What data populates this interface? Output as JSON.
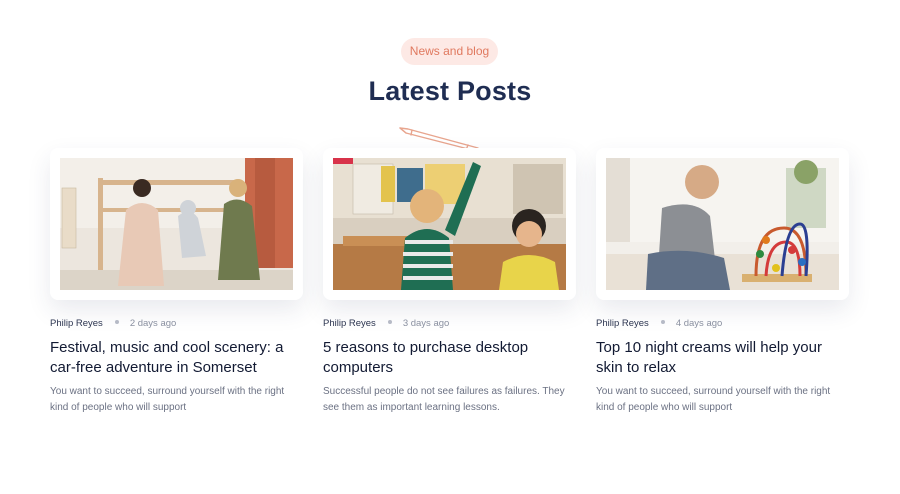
{
  "section": {
    "eyebrow": "News and blog",
    "title": "Latest Posts"
  },
  "posts": [
    {
      "image_icon": "photo-children-playing-with-toys",
      "author": "Philip Reyes",
      "date": "2 days ago",
      "title": "Festival, music and cool scenery: a car-free adventure in Somerset",
      "excerpt": "You want to succeed, surround yourself with the right kind of people who will support"
    },
    {
      "image_icon": "photo-children-in-classroom",
      "author": "Philip Reyes",
      "date": "3 days ago",
      "title": "5 reasons to purchase desktop computers",
      "excerpt": "Successful people do not see failures as failures. They see them as important learning lessons."
    },
    {
      "image_icon": "photo-toddler-with-bead-maze",
      "author": "Philip Reyes",
      "date": "4 days ago",
      "title": "Top 10 night creams will help your skin to relax",
      "excerpt": "You want to succeed, surround yourself with the right kind of people who will support"
    }
  ],
  "colors": {
    "accent": "#e0795f",
    "accent_bg": "#fde9e5",
    "heading": "#1f2d52",
    "text_muted": "#6b7183"
  }
}
